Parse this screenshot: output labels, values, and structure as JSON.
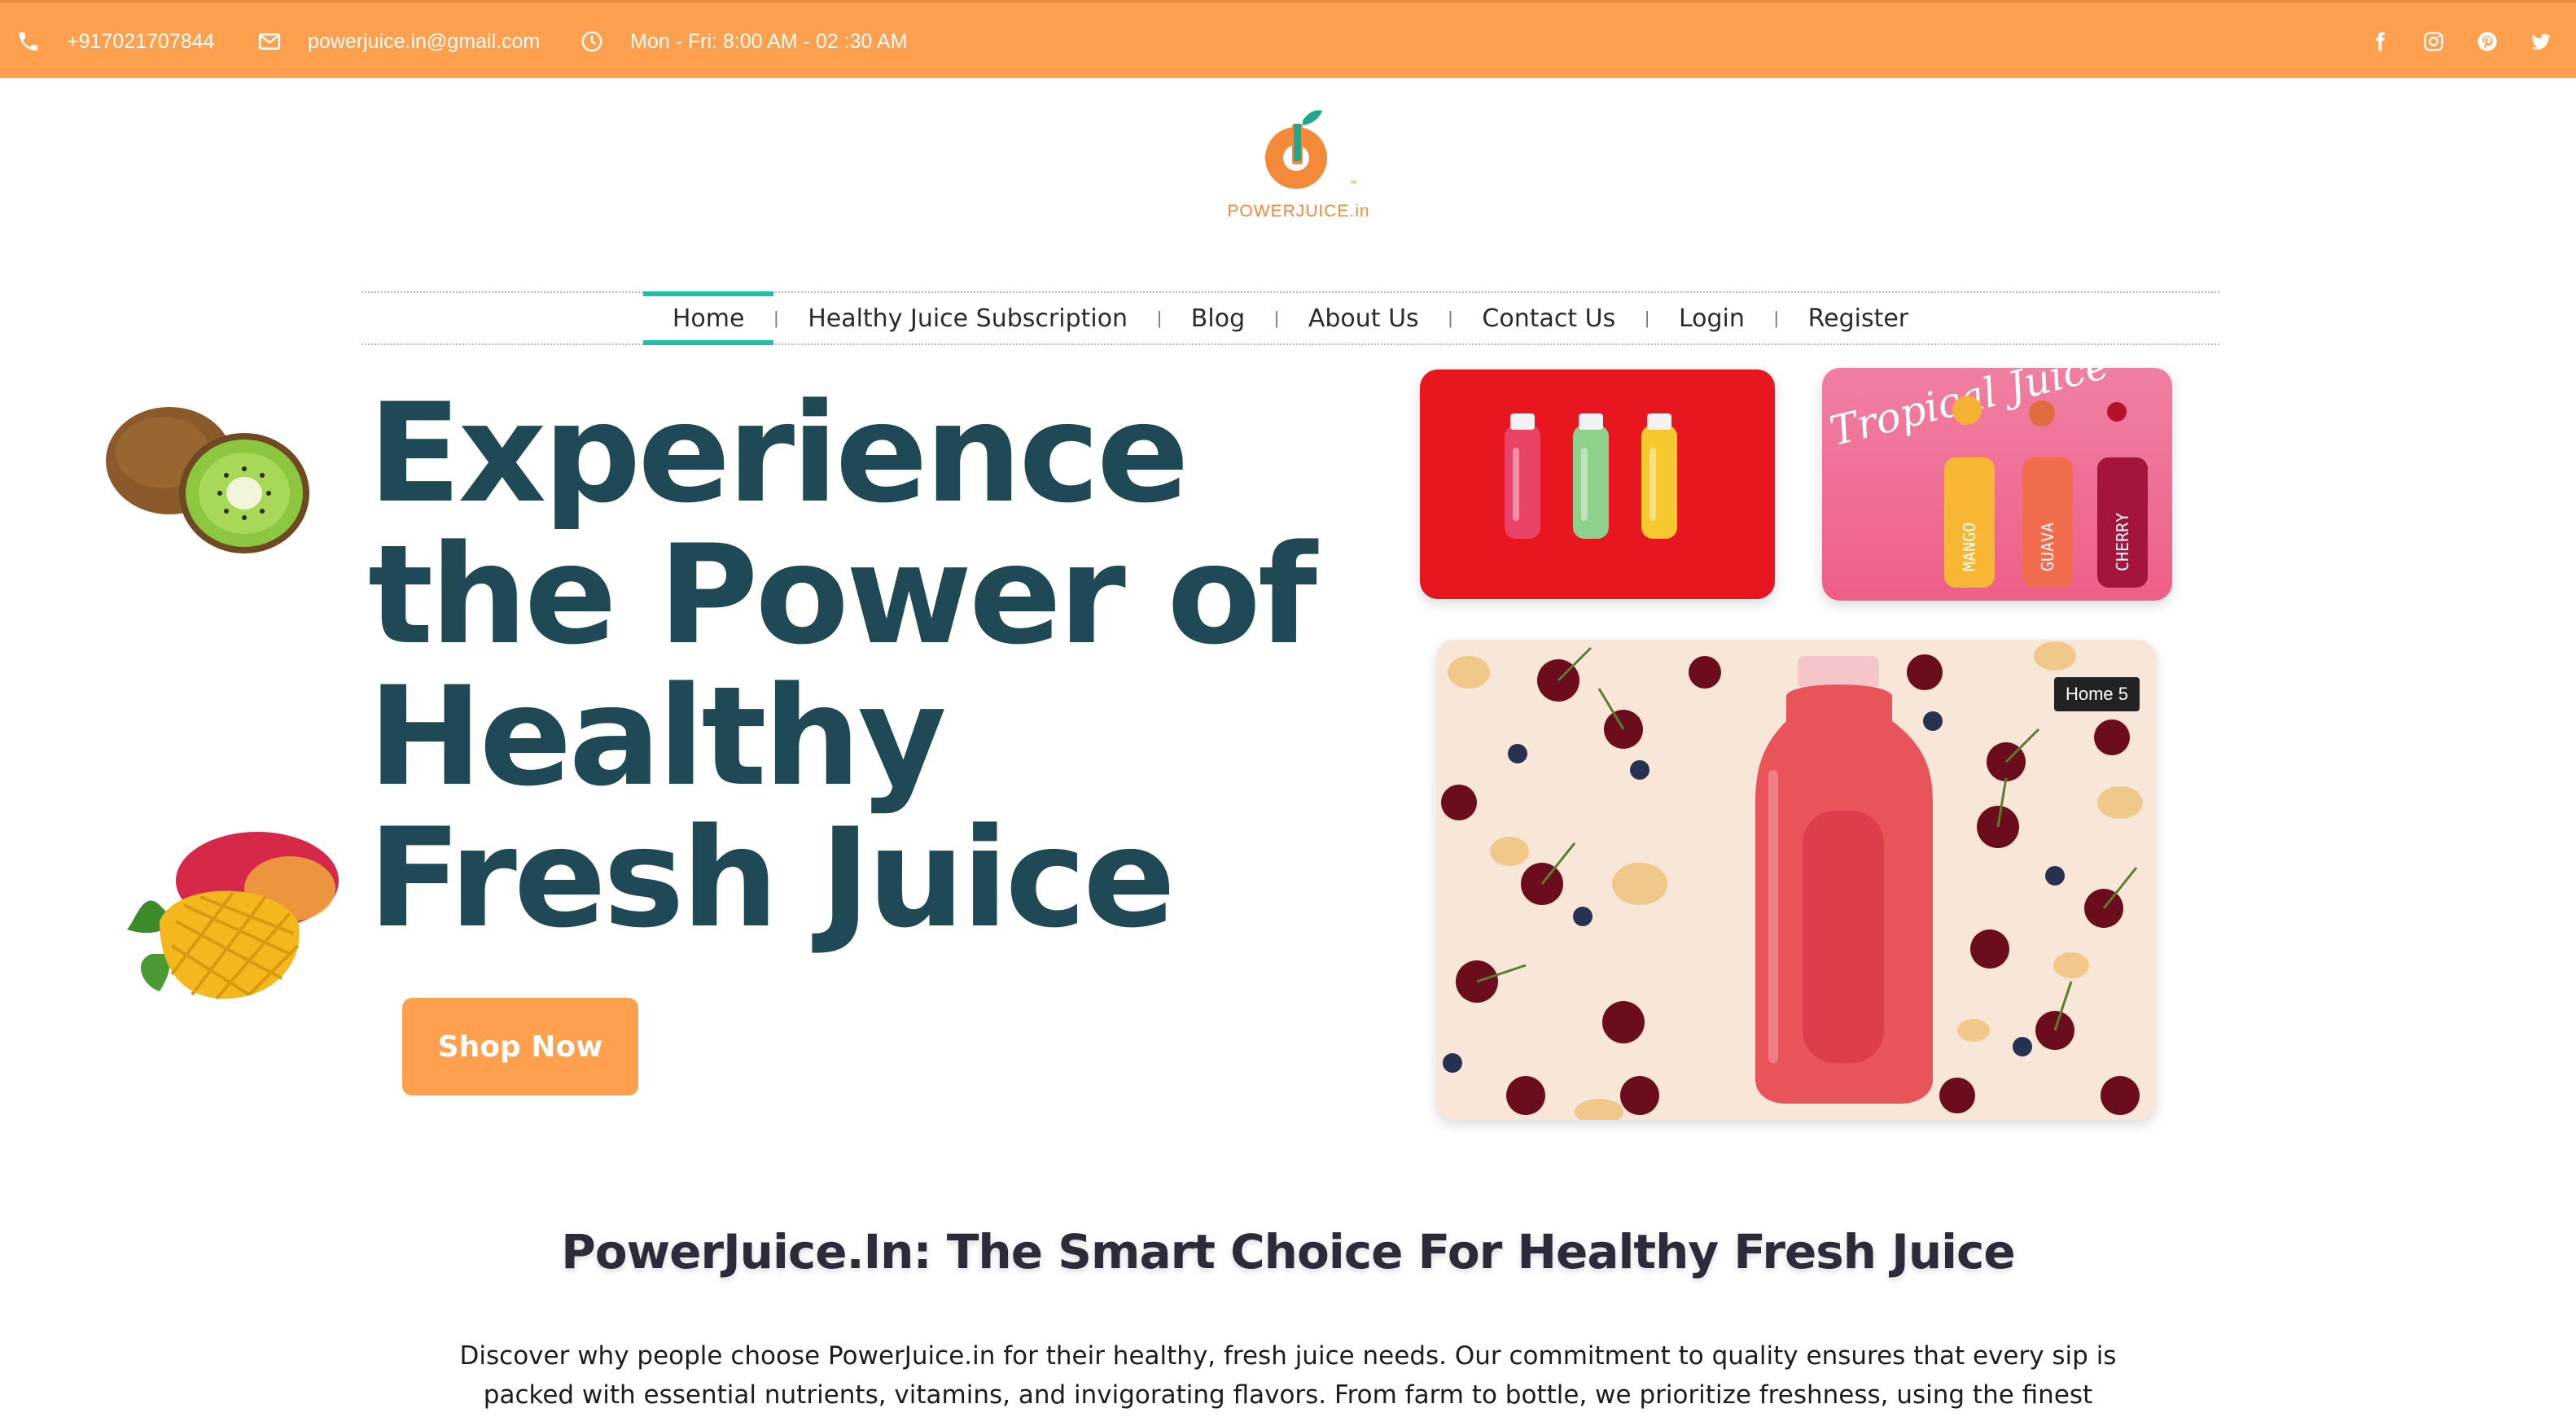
{
  "topbar": {
    "phone": "+917021707844",
    "email": "powerjuice.in@gmail.com",
    "hours": "Mon - Fri: 8:00 AM - 02 :30 AM",
    "social": [
      "facebook-icon",
      "instagram-icon",
      "pinterest-icon",
      "twitter-icon"
    ],
    "background": "#FFA04F"
  },
  "logo": {
    "text": "POWERJUICE.in"
  },
  "nav": {
    "items": [
      "Home",
      "Healthy Juice Subscription",
      "Blog",
      "About Us",
      "Contact Us",
      "Login",
      "Register"
    ],
    "active": "Home",
    "accent": "#1fbfa8"
  },
  "hero": {
    "title": "Experience the Power of Healthy Fresh Juice",
    "button": "Shop Now",
    "title_color": "#1f4a55",
    "tooltip": "Home 5",
    "bottle_labels": [
      "MANGO",
      "GUAVA",
      "CHERRY"
    ],
    "tropical_text": "Tropical Juice"
  },
  "section": {
    "title": "PowerJuice.In: The Smart Choice For Healthy Fresh Juice",
    "description": "Discover why people choose PowerJuice.in for their healthy, fresh juice needs. Our commitment to quality ensures that every sip is packed with essential nutrients, vitamins, and invigorating flavors. From farm to bottle, we prioritize freshness, using the finest ingredients to deliver"
  }
}
